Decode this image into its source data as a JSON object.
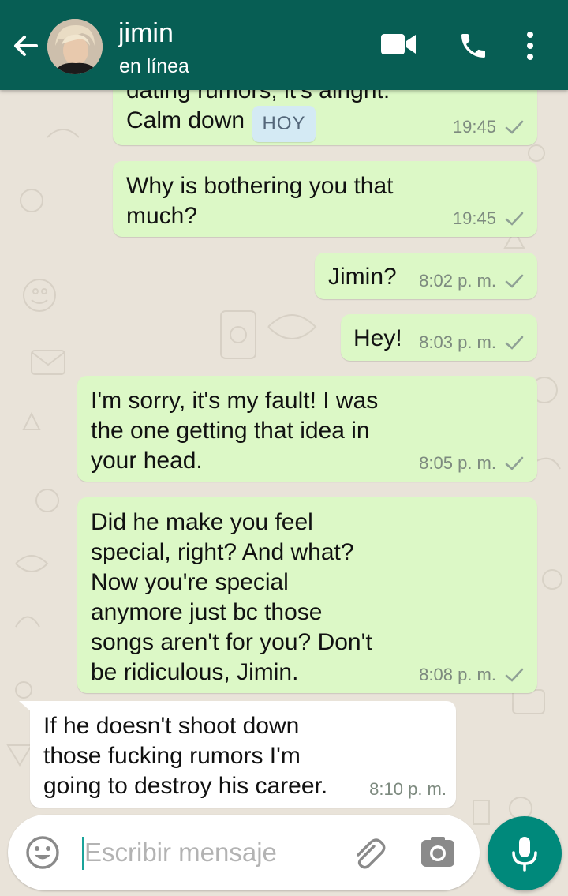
{
  "header": {
    "contact_name": "jimin",
    "status": "en línea",
    "colors": {
      "bar": "#075e54",
      "text": "#ffffff"
    },
    "icons": [
      "back-arrow-icon",
      "avatar",
      "video-call-icon",
      "phone-call-icon",
      "more-options-icon"
    ]
  },
  "chat": {
    "day_badge": "HOY",
    "messages": [
      {
        "direction": "outgoing",
        "text": "dating rumors, it's alright.\nCalm down",
        "time": "19:45",
        "status": "sent"
      },
      {
        "direction": "outgoing",
        "text": "Why is bothering you that\nmuch?",
        "time": "19:45",
        "status": "sent"
      },
      {
        "direction": "outgoing",
        "text": "Jimin?",
        "time": "8:02 p. m.",
        "status": "sent"
      },
      {
        "direction": "outgoing",
        "text": "Hey!",
        "time": "8:03 p. m.",
        "status": "sent"
      },
      {
        "direction": "outgoing",
        "text": "I'm sorry, it's my fault! I was\nthe one getting that idea in\nyour head.",
        "time": "8:05 p. m.",
        "status": "sent"
      },
      {
        "direction": "outgoing",
        "text": "Did he make you feel\nspecial, right? And what?\nNow you're special\nanymore just bc those\nsongs aren't for you? Don't\nbe ridiculous, Jimin.",
        "time": "8:08 p. m.",
        "status": "sent"
      },
      {
        "direction": "incoming",
        "text": "If he doesn't shoot down\nthose fucking rumors I'm\ngoing to destroy his career.",
        "time": "8:10 p. m."
      }
    ],
    "colors": {
      "outgoing": "#dcf8c6",
      "incoming": "#ffffff",
      "wallpaper": "#e9e3d9",
      "tick": "#8fa095"
    }
  },
  "composer": {
    "placeholder": "Escribir mensaje",
    "value": "",
    "icons": [
      "emoji-icon",
      "attach-icon",
      "camera-icon",
      "mic-icon"
    ],
    "colors": {
      "mic_button": "#00897b"
    }
  }
}
